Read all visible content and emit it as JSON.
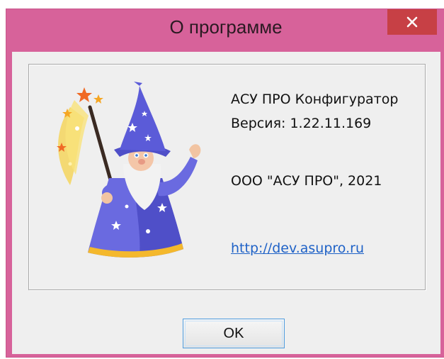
{
  "window": {
    "title": "О программе",
    "close_icon": "close-icon"
  },
  "about": {
    "product": "АСУ ПРО Конфигуратор",
    "version": "Версия: 1.22.11.169",
    "copyright": "ООО \"АСУ ПРО\", 2021",
    "link": "http://dev.asupro.ru",
    "illustration": "wizard-illustration"
  },
  "buttons": {
    "ok_label": "OK"
  },
  "colors": {
    "titlebar": "#d7629a",
    "close_button": "#c74045",
    "link": "#1f62c7",
    "button_border": "#4f9de0"
  }
}
